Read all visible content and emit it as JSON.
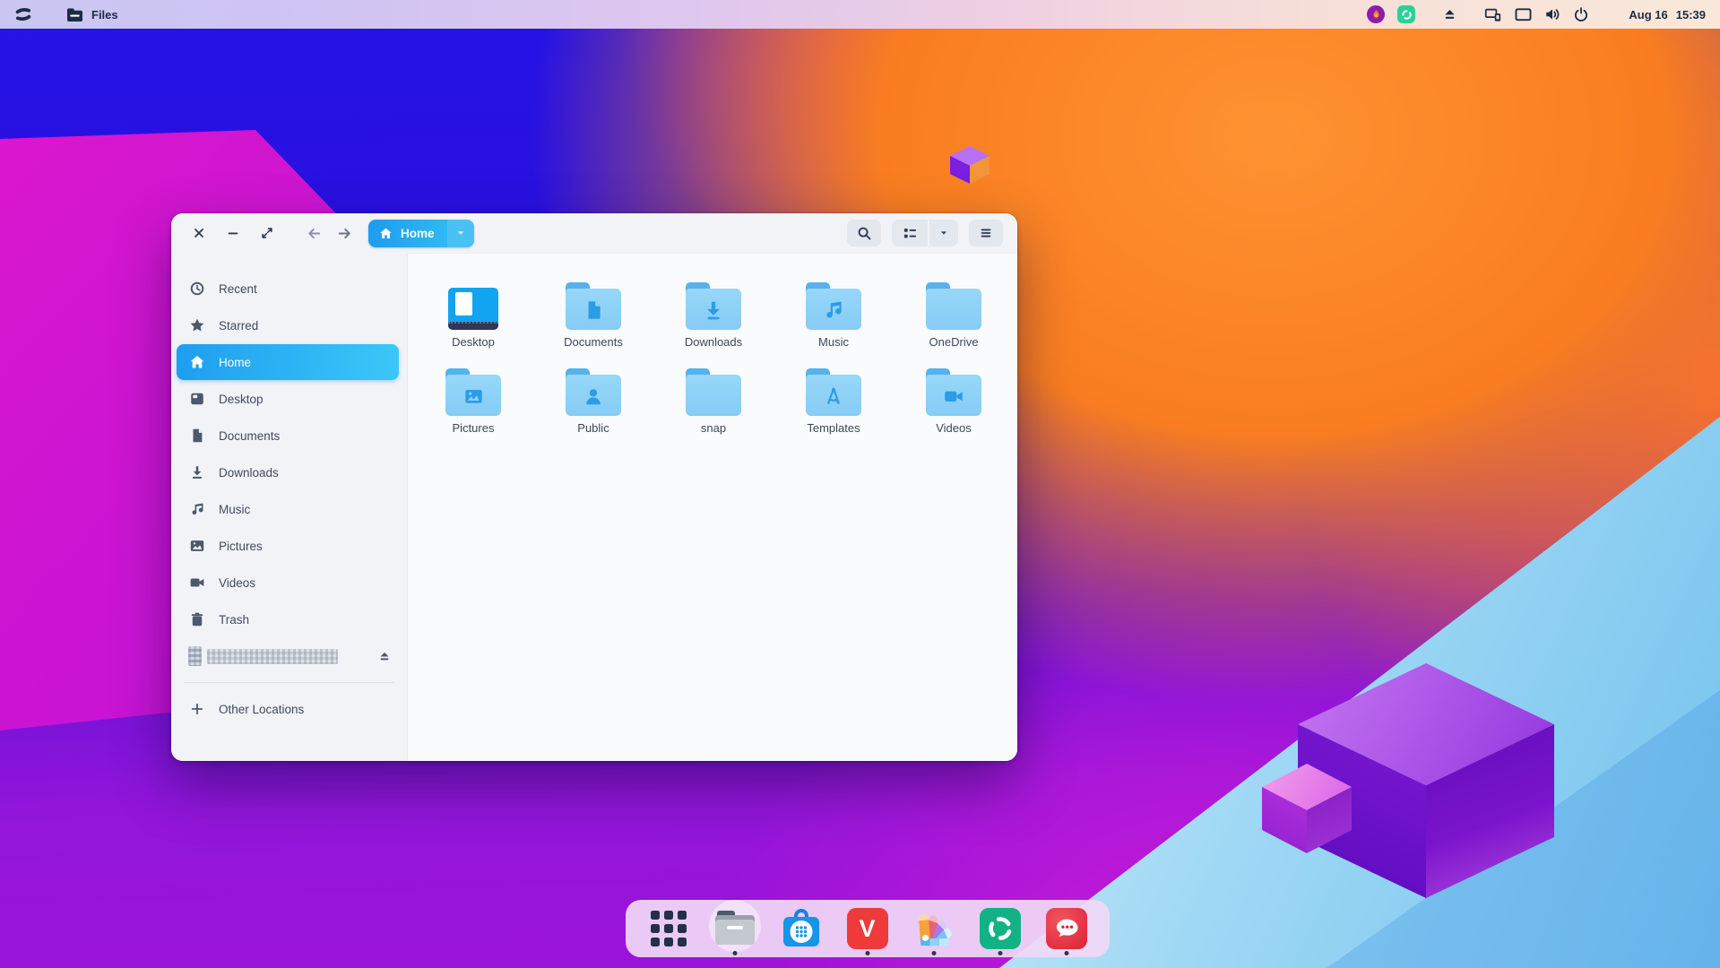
{
  "topbar": {
    "app_title": "Files",
    "clock_date": "Aug 16",
    "clock_time": "15:39",
    "tray_icons": [
      "flame-indicator-icon",
      "connect-indicator-icon",
      "eject-icon",
      "devices-icon",
      "display-icon",
      "volume-icon",
      "power-icon"
    ]
  },
  "window": {
    "path_button": {
      "label": "Home"
    },
    "controls": [
      "close",
      "minimize",
      "maximize"
    ],
    "toolbar": [
      "search",
      "list-view",
      "view-options-dropdown",
      "menu"
    ]
  },
  "sidebar": {
    "items": [
      {
        "label": "Recent",
        "icon": "clock-icon",
        "selected": false
      },
      {
        "label": "Starred",
        "icon": "star-icon",
        "selected": false
      },
      {
        "label": "Home",
        "icon": "home-icon",
        "selected": true
      },
      {
        "label": "Desktop",
        "icon": "desktop-icon",
        "selected": false
      },
      {
        "label": "Documents",
        "icon": "document-icon",
        "selected": false
      },
      {
        "label": "Downloads",
        "icon": "download-icon",
        "selected": false
      },
      {
        "label": "Music",
        "icon": "music-icon",
        "selected": false
      },
      {
        "label": "Pictures",
        "icon": "image-icon",
        "selected": false
      },
      {
        "label": "Videos",
        "icon": "camera-icon",
        "selected": false
      },
      {
        "label": "Trash",
        "icon": "trash-icon",
        "selected": false
      }
    ],
    "device": {
      "label_redacted": true,
      "eject_icon": "eject-icon"
    },
    "other_locations": {
      "label": "Other Locations",
      "icon": "plus-icon"
    }
  },
  "files": {
    "items": [
      {
        "name": "Desktop",
        "glyph": "desktop"
      },
      {
        "name": "Documents",
        "glyph": "document"
      },
      {
        "name": "Downloads",
        "glyph": "download"
      },
      {
        "name": "Music",
        "glyph": "music"
      },
      {
        "name": "OneDrive",
        "glyph": "plain"
      },
      {
        "name": "Pictures",
        "glyph": "image"
      },
      {
        "name": "Public",
        "glyph": "person"
      },
      {
        "name": "snap",
        "glyph": "plain"
      },
      {
        "name": "Templates",
        "glyph": "compass"
      },
      {
        "name": "Videos",
        "glyph": "camera"
      }
    ]
  },
  "dock": {
    "items": [
      {
        "name": "app-grid",
        "running": false
      },
      {
        "name": "files",
        "running": true
      },
      {
        "name": "software",
        "running": false
      },
      {
        "name": "vivaldi",
        "running": true,
        "letter": "V"
      },
      {
        "name": "color-picker",
        "running": true
      },
      {
        "name": "sync-app",
        "running": true
      },
      {
        "name": "chat-app",
        "running": true
      }
    ]
  },
  "colors": {
    "accent_blue": "#2fa9f2",
    "selection_gradient": [
      "#1f9df0",
      "#3ac8f7"
    ],
    "folder_body": "#8ed1f7",
    "folder_tab": "#55b2ec",
    "folder_glyph": "#2b9ce8",
    "topbar_text": "#1d2b45",
    "sidebar_text": "#3f4a5c"
  }
}
